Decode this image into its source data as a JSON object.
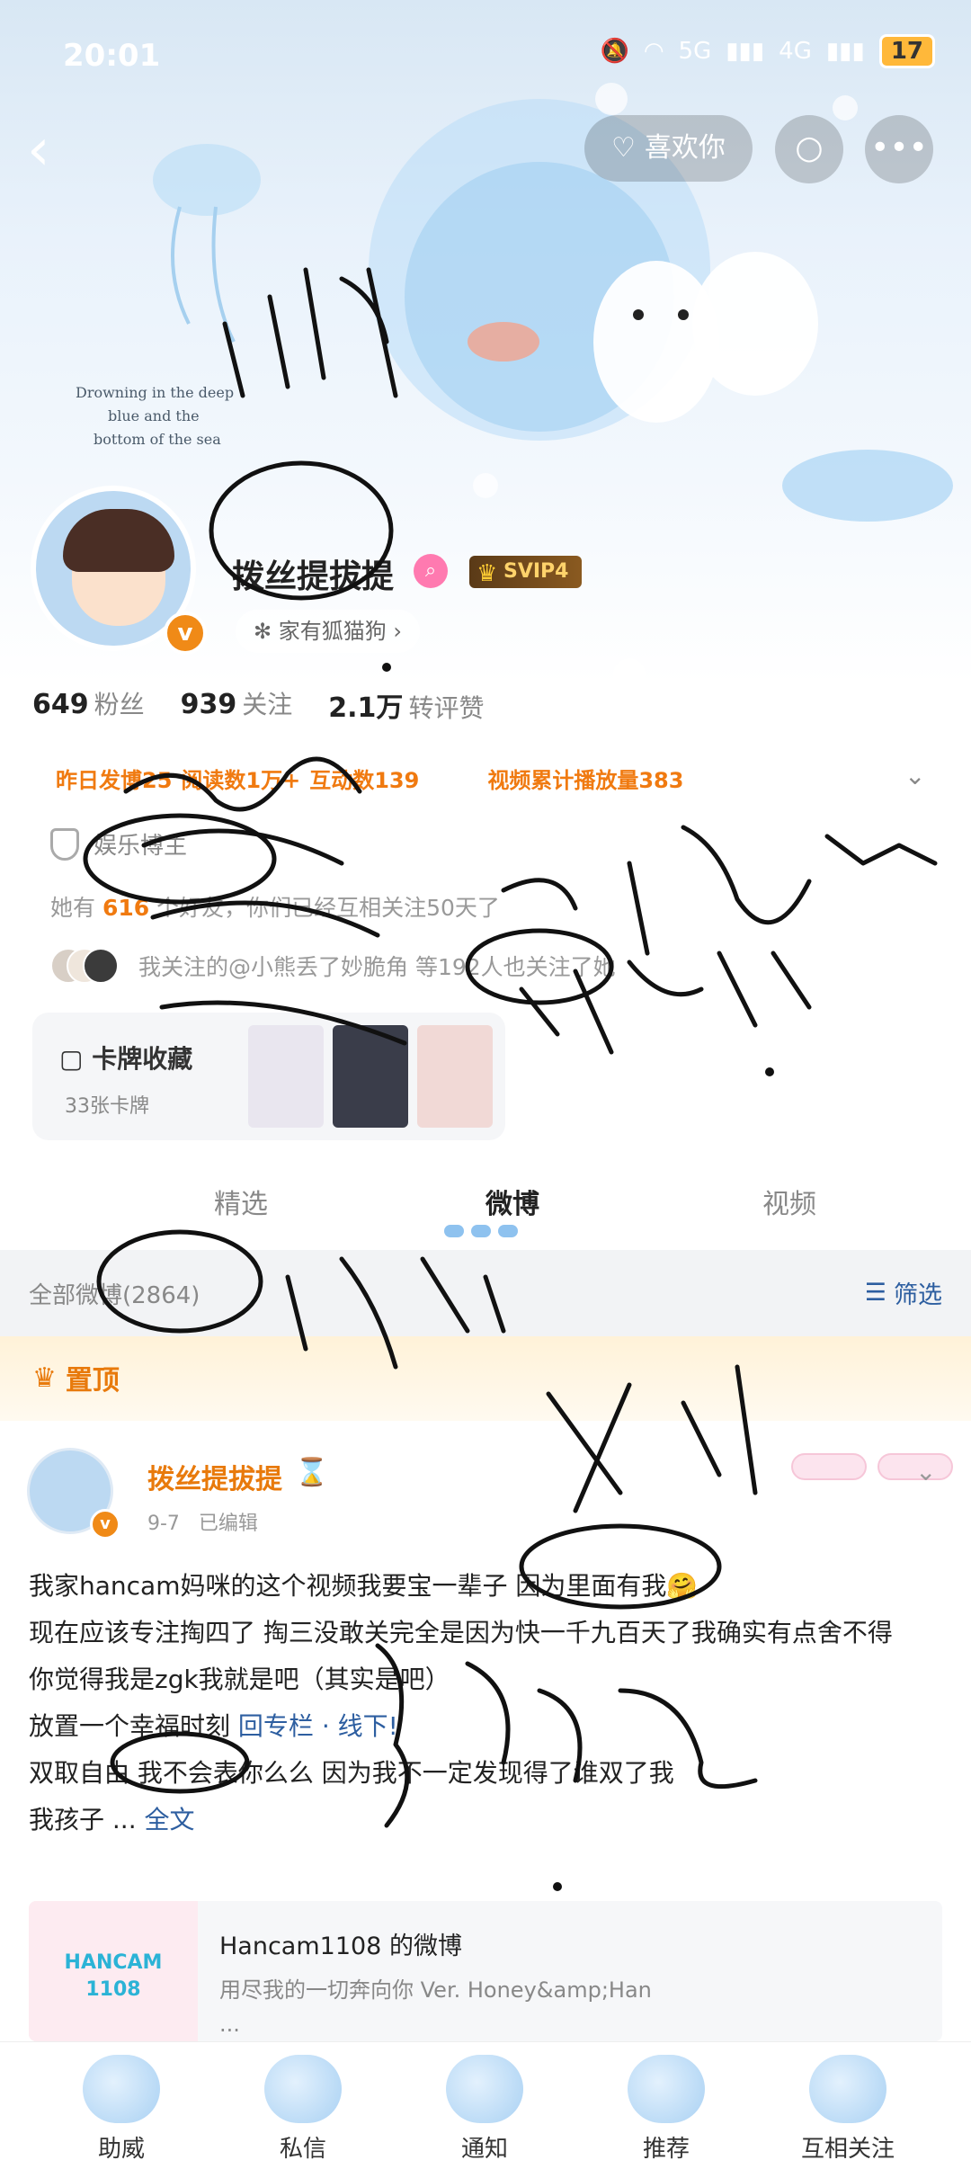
{
  "status_bar": {
    "time": "20:01",
    "signal_5g": "5G",
    "signal_4g": "4G",
    "battery": "17"
  },
  "top_nav": {
    "like_label": "喜欢你"
  },
  "header_art": {
    "caption": "Drowning in the deep blue and the bottom of the sea"
  },
  "profile": {
    "nickname": "拨丝提拔提",
    "svip": "SVIP4",
    "pet_tag": "家有狐猫狗",
    "stats": [
      {
        "value": "649",
        "label": "粉丝"
      },
      {
        "value": "939",
        "label": "关注"
      },
      {
        "value": "2.1万",
        "label": "转评赞"
      }
    ],
    "tasks": [
      "昨日发博25",
      "阅读数1万+",
      "互动数139",
      "视频累计播放量383"
    ],
    "verify": "娱乐博主",
    "friends_prefix": "她有",
    "friends_count": "616",
    "friends_suffix": "个好友，你们已经互相关注50天了",
    "mutual": "我关注的@小熊丢了妙脆角 等192人也关注了她",
    "cards": {
      "title": "卡牌收藏",
      "subtitle": "33张卡牌"
    }
  },
  "tabs": [
    "精选",
    "微博",
    "视频"
  ],
  "filter": {
    "all_label": "全部微博(2864)",
    "filter_label": "筛选"
  },
  "pinned_label": "置顶",
  "post": {
    "author": "拨丝提拔提",
    "date": "9-7",
    "edited": "已编辑",
    "line1": "我家hancam妈咪的这个视频我要宝一辈子 因为里面有我🤗",
    "line2": "现在应该专注掏四了 掏三没敢关完全是因为快一千九百天了我确实有点舍不得",
    "line3": "你觉得我是zgk我就是吧（其实是吧）",
    "line4_text": "放置一个幸福时刻",
    "line4_link": "回专栏 · 线下!",
    "line5": "双取自由 我不会表你么么 因为我不一定发现得了谁双了我",
    "line6_text": "我孩子 ...",
    "line6_link": "全文",
    "embed": {
      "logo_top": "HANCAM",
      "logo_bottom": "1108",
      "title": "Hancam1108 的微博",
      "desc_line1": "用尽我的一切奔向你 Ver. Honey&amp;Han",
      "desc_line2": "..."
    }
  },
  "bottom_nav": [
    "助威",
    "私信",
    "通知",
    "推荐",
    "互相关注"
  ],
  "colors": {
    "accent_orange": "#e87a0c",
    "link_blue": "#2d5ea0",
    "svip_gold": "#ffd36b"
  },
  "icons": [
    "back-icon",
    "heart-hand-icon",
    "search-icon",
    "more-icon",
    "filter-icon",
    "crown-icon",
    "shield-icon",
    "hourglass-icon"
  ]
}
